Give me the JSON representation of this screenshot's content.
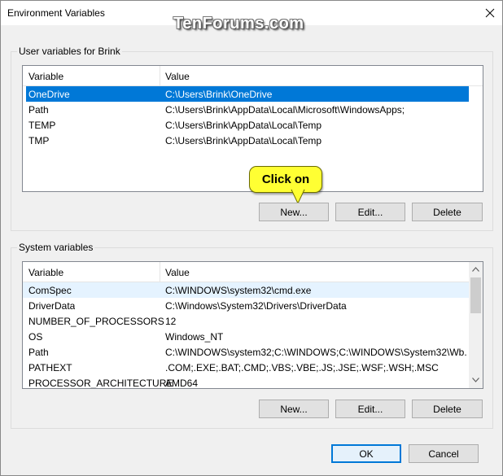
{
  "window": {
    "title": "Environment Variables",
    "watermark": "TenForums.com"
  },
  "user_vars": {
    "group_label": "User variables for Brink",
    "columns": [
      "Variable",
      "Value"
    ],
    "rows": [
      {
        "variable": "OneDrive",
        "value": "C:\\Users\\Brink\\OneDrive",
        "selected": true
      },
      {
        "variable": "Path",
        "value": "C:\\Users\\Brink\\AppData\\Local\\Microsoft\\WindowsApps;",
        "selected": false
      },
      {
        "variable": "TEMP",
        "value": "C:\\Users\\Brink\\AppData\\Local\\Temp",
        "selected": false
      },
      {
        "variable": "TMP",
        "value": "C:\\Users\\Brink\\AppData\\Local\\Temp",
        "selected": false
      }
    ],
    "buttons": {
      "new": "New...",
      "edit": "Edit...",
      "delete": "Delete"
    }
  },
  "callout": {
    "text": "Click on"
  },
  "system_vars": {
    "group_label": "System variables",
    "columns": [
      "Variable",
      "Value"
    ],
    "rows": [
      {
        "variable": "ComSpec",
        "value": "C:\\WINDOWS\\system32\\cmd.exe"
      },
      {
        "variable": "DriverData",
        "value": "C:\\Windows\\System32\\Drivers\\DriverData"
      },
      {
        "variable": "NUMBER_OF_PROCESSORS",
        "value": "12"
      },
      {
        "variable": "OS",
        "value": "Windows_NT"
      },
      {
        "variable": "Path",
        "value": "C:\\WINDOWS\\system32;C:\\WINDOWS;C:\\WINDOWS\\System32\\Wb..."
      },
      {
        "variable": "PATHEXT",
        "value": ".COM;.EXE;.BAT;.CMD;.VBS;.VBE;.JS;.JSE;.WSF;.WSH;.MSC"
      },
      {
        "variable": "PROCESSOR_ARCHITECTURE",
        "value": "AMD64"
      }
    ],
    "buttons": {
      "new": "New...",
      "edit": "Edit...",
      "delete": "Delete"
    }
  },
  "dialog_buttons": {
    "ok": "OK",
    "cancel": "Cancel"
  },
  "colors": {
    "selection": "#0078d7",
    "callout": "#ffff33"
  }
}
